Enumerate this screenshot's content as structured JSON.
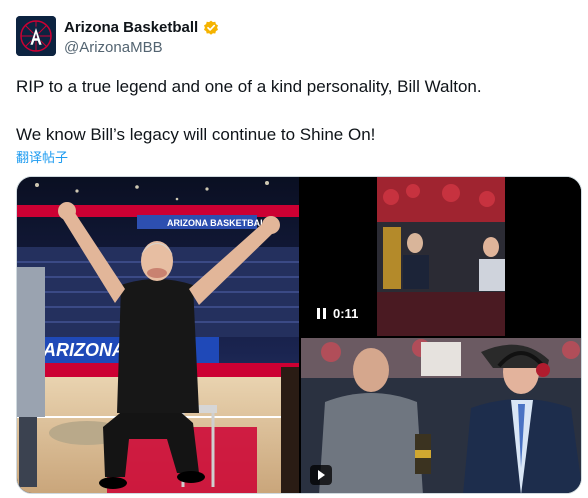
{
  "account": {
    "name": "Arizona Basketball",
    "handle": "@ArizonaMBB",
    "avatar_icon": "arizona-a-logo",
    "verified_icon": "verified-badge-icon",
    "verified_color": "#f5b300"
  },
  "tweet": {
    "line1": "RIP to a true legend and one of a kind personality, Bill Walton.",
    "line2": "We know Bill’s legacy will continue to Shine On!",
    "translate_label": "翻译帖子"
  },
  "media": {
    "photo_banner_text": "ARIZONA BASKETBALL",
    "video": {
      "duration": "0:11",
      "pause_icon": "pause-icon"
    },
    "clip": {
      "play_icon": "play-icon"
    }
  },
  "colors": {
    "arizona_navy": "#0c2340",
    "arizona_red": "#cc0033",
    "link_blue": "#1d9bf0"
  }
}
